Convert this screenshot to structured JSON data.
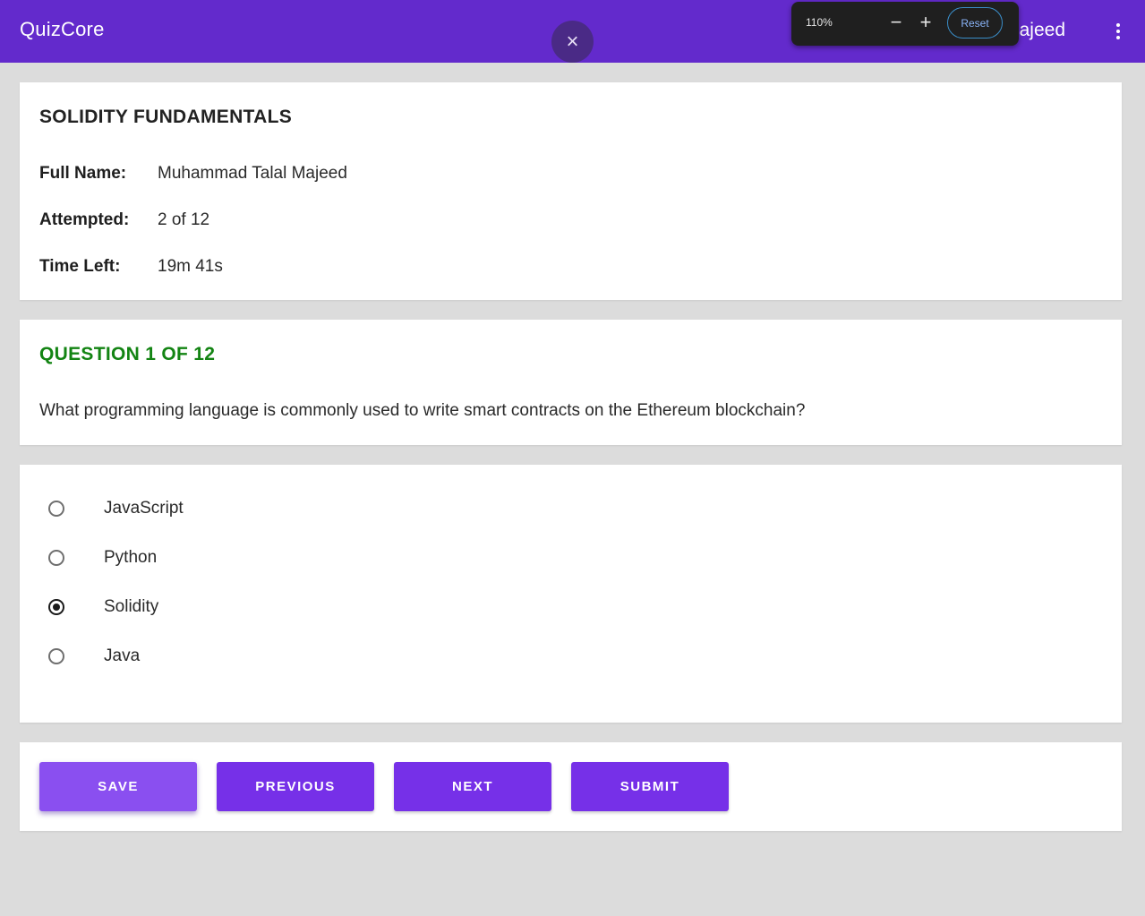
{
  "appbar": {
    "brand": "QuizCore",
    "user_name_visible": "ajeed",
    "menu_icon": "more-vert-icon",
    "color": "#632acc"
  },
  "overlay": {
    "close_icon": "×"
  },
  "zoom": {
    "level": "110%",
    "minus": "−",
    "plus": "+",
    "reset_label": "Reset"
  },
  "quiz": {
    "title": "SOLIDITY FUNDAMENTALS",
    "info": [
      {
        "label": "Full Name:",
        "value": "Muhammad Talal Majeed"
      },
      {
        "label": "Attempted:",
        "value": "2 of 12"
      },
      {
        "label": "Time Left:",
        "value": "19m 41s"
      }
    ]
  },
  "question": {
    "heading": "QUESTION 1 OF 12",
    "heading_color": "#138413",
    "text": "What programming language is commonly used to write smart contracts on the Ethereum blockchain?"
  },
  "options": [
    {
      "label": "JavaScript",
      "selected": false
    },
    {
      "label": "Python",
      "selected": false
    },
    {
      "label": "Solidity",
      "selected": true
    },
    {
      "label": "Java",
      "selected": false
    }
  ],
  "actions": {
    "save": "SAVE",
    "previous": "PREVIOUS",
    "next": "NEXT",
    "submit": "SUBMIT",
    "button_color": "#7630e8"
  }
}
